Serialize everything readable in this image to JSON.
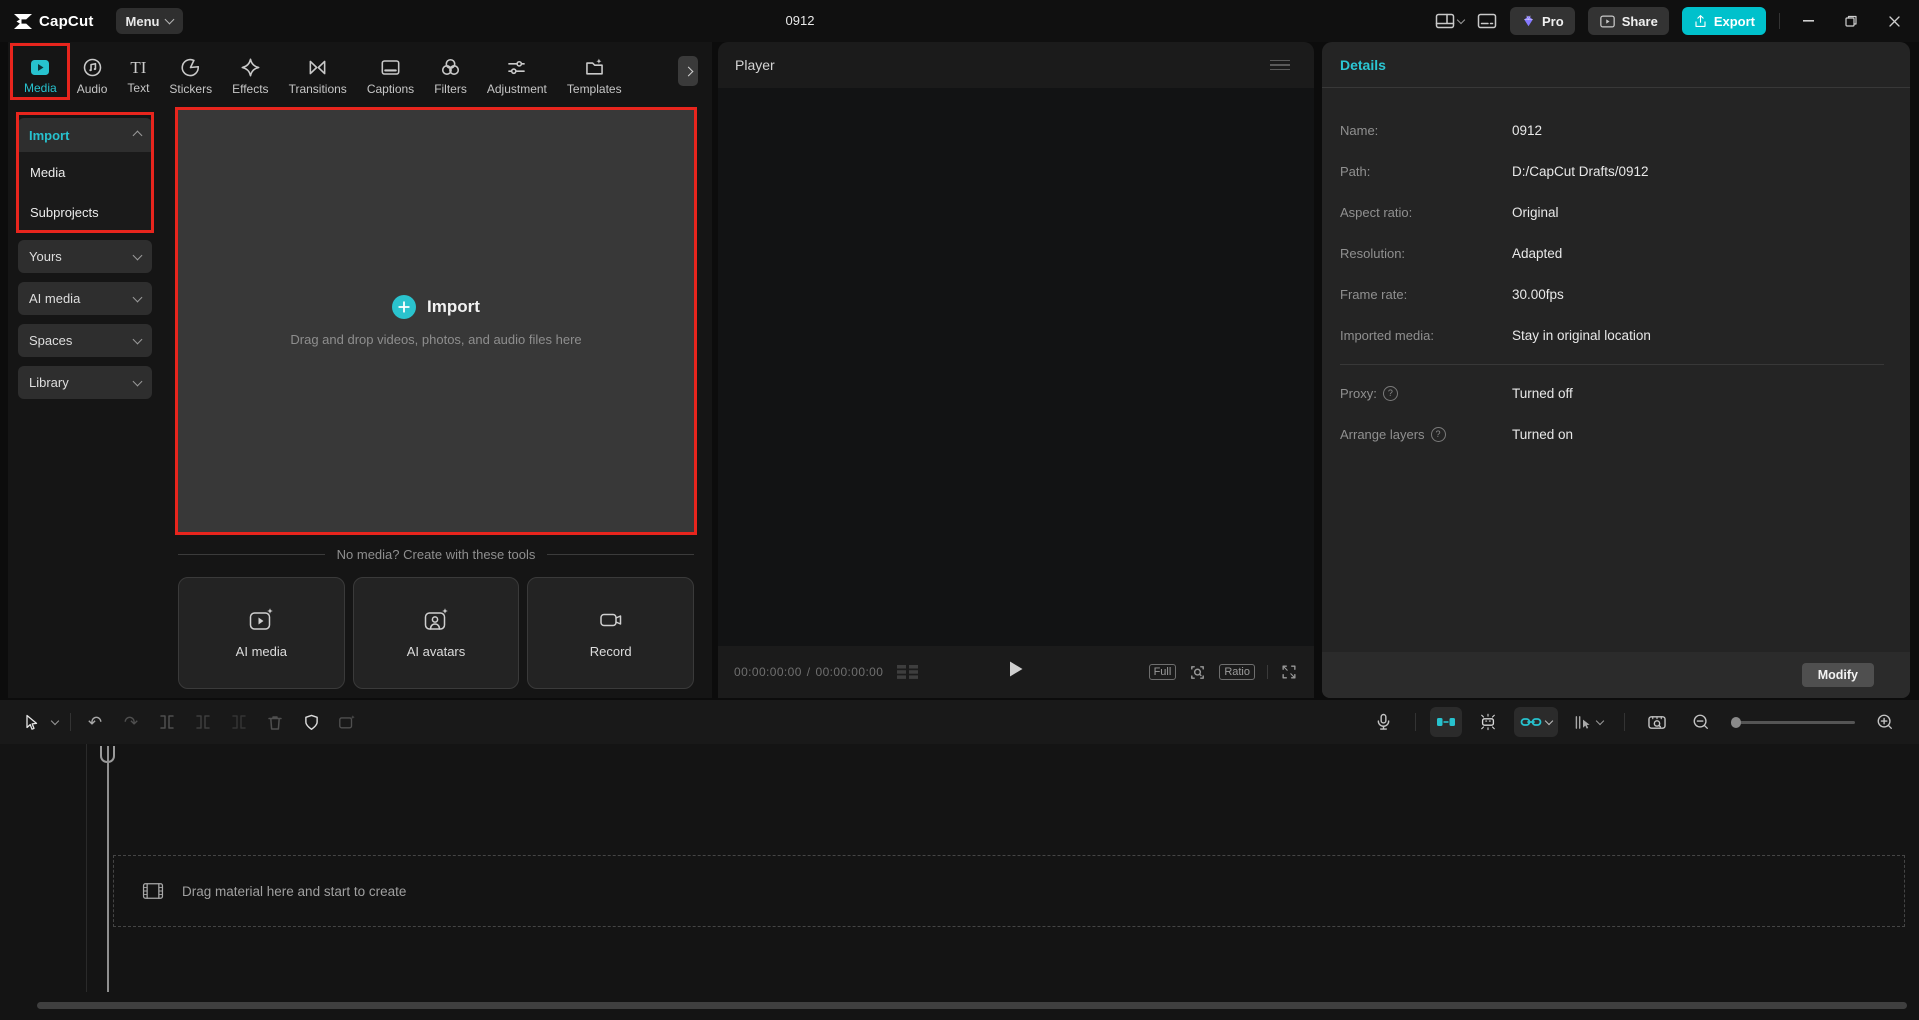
{
  "colors": {
    "accent": "#27c2ce",
    "export_button": "#00c1cc",
    "annotation_red": "#e8251d",
    "pro_diamond": "#8679ff"
  },
  "titlebar": {
    "app_name": "CapCut",
    "menu_label": "Menu",
    "doc_title": "0912",
    "pro_label": "Pro",
    "share_label": "Share",
    "export_label": "Export"
  },
  "tabs": [
    {
      "label": "Media",
      "active": true
    },
    {
      "label": "Audio"
    },
    {
      "label": "Text"
    },
    {
      "label": "Stickers"
    },
    {
      "label": "Effects"
    },
    {
      "label": "Transitions"
    },
    {
      "label": "Captions"
    },
    {
      "label": "Filters"
    },
    {
      "label": "Adjustment"
    },
    {
      "label": "Templates"
    }
  ],
  "text_tab_icon_glyph": "TI",
  "sidebar": {
    "import_group": {
      "label": "Import",
      "items": [
        {
          "label": "Media"
        },
        {
          "label": "Subprojects"
        }
      ]
    },
    "groups": [
      {
        "label": "Yours"
      },
      {
        "label": "AI media"
      },
      {
        "label": "Spaces"
      },
      {
        "label": "Library"
      }
    ]
  },
  "import_area": {
    "title": "Import",
    "hint": "Drag and drop videos, photos, and audio files here"
  },
  "create_tools": {
    "divider_label": "No media? Create with these tools",
    "cards": [
      {
        "label": "AI media"
      },
      {
        "label": "AI avatars"
      },
      {
        "label": "Record"
      }
    ]
  },
  "player": {
    "title": "Player",
    "current_time": "00:00:00:00",
    "time_separator": "/",
    "total_time": "00:00:00:00",
    "full_label": "Full",
    "ratio_label": "Ratio"
  },
  "details": {
    "title": "Details",
    "rows": [
      {
        "label": "Name:",
        "value": "0912"
      },
      {
        "label": "Path:",
        "value": "D:/CapCut Drafts/0912"
      },
      {
        "label": "Aspect ratio:",
        "value": "Original"
      },
      {
        "label": "Resolution:",
        "value": "Adapted"
      },
      {
        "label": "Frame rate:",
        "value": "30.00fps"
      },
      {
        "label": "Imported media:",
        "value": "Stay in original location"
      }
    ],
    "toggle_rows": [
      {
        "label": "Proxy:",
        "value": "Turned off"
      },
      {
        "label": "Arrange layers",
        "value": "Turned on"
      }
    ],
    "help_glyph": "?",
    "modify_label": "Modify"
  },
  "timeline": {
    "empty_hint": "Drag material here and start to create"
  }
}
